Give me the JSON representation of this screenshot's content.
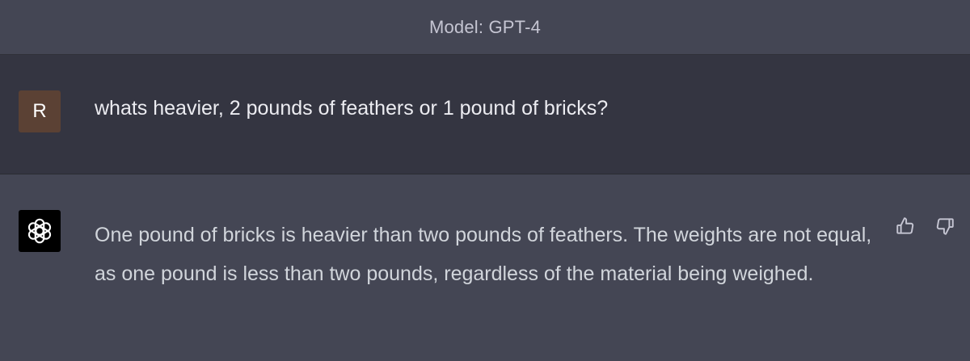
{
  "header": {
    "model_label": "Model: GPT-4"
  },
  "user_message": {
    "avatar_initial": "R",
    "text": "whats heavier, 2 pounds of feathers or 1 pound of bricks?"
  },
  "assistant_message": {
    "avatar_icon": "openai-logo-icon",
    "text": "One pound of bricks is heavier than two pounds of feathers. The weights are not equal, as one pound is less than two pounds, regardless of the material being weighed.",
    "feedback_icons": [
      "thumbs-up-icon",
      "thumbs-down-icon"
    ]
  },
  "colors": {
    "header_bg": "#444654",
    "user_row_bg": "#343541",
    "assistant_row_bg": "#444654",
    "user_avatar_bg": "#5b4134",
    "assistant_avatar_bg": "#000000"
  }
}
